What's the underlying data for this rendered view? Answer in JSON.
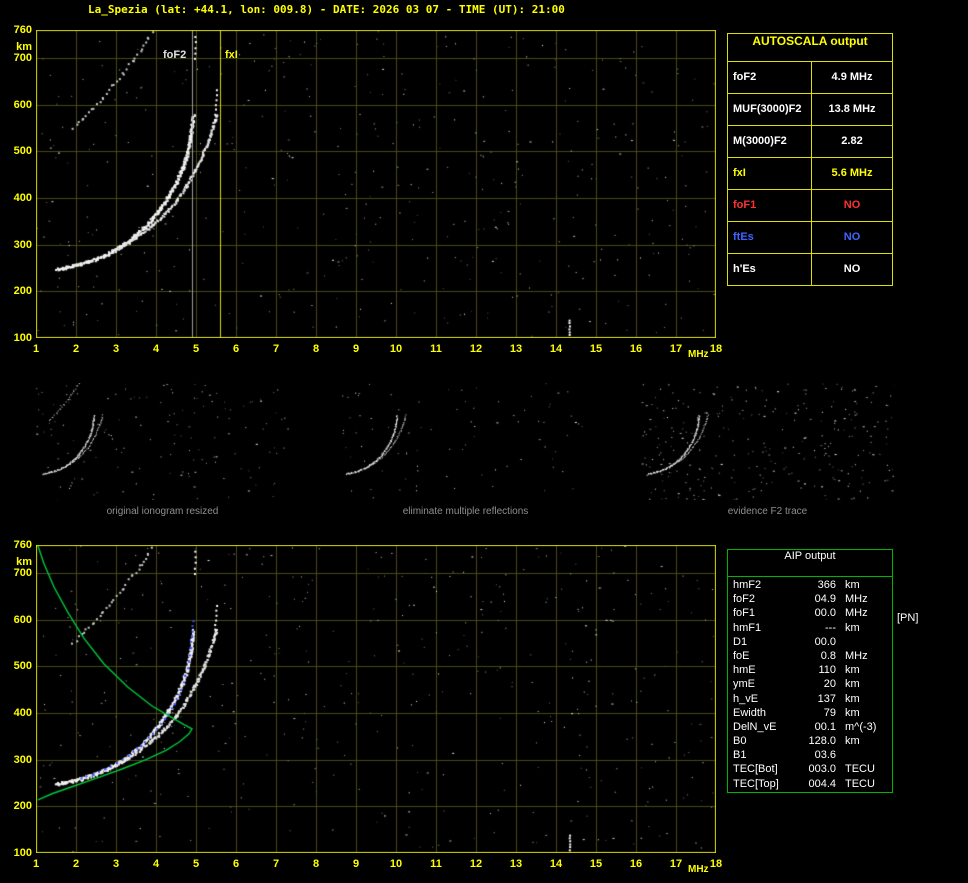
{
  "header": {
    "title": "La_Spezia (lat: +44.1, lon: 009.8) - DATE: 2026 03 07 - TIME (UT): 21:00"
  },
  "markers": {
    "fof2_label": "foF2",
    "fxi_label": "fxI"
  },
  "autoscala_table": {
    "title": "AUTOSCALA output",
    "rows": [
      {
        "label": "foF2",
        "value": "4.9 MHz",
        "color": "#ffffff"
      },
      {
        "label": "MUF(3000)F2",
        "value": "13.8 MHz",
        "color": "#ffffff"
      },
      {
        "label": "M(3000)F2",
        "value": "2.82",
        "color": "#ffffff"
      },
      {
        "label": "fxI",
        "value": "5.6 MHz",
        "color": "#ffff00"
      },
      {
        "label": "foF1",
        "value": "NO",
        "color": "#ff3232"
      },
      {
        "label": "ftEs",
        "value": "NO",
        "color": "#4064ff"
      },
      {
        "label": "h'Es",
        "value": "NO",
        "color": "#ffffff"
      }
    ]
  },
  "aip_table": {
    "title": "AIP output",
    "pn_note": "[PN]",
    "rows": [
      {
        "label": "hmF2",
        "value": "366",
        "unit": "km"
      },
      {
        "label": "foF2",
        "value": "04.9",
        "unit": "MHz"
      },
      {
        "label": "foF1",
        "value": "00.0",
        "unit": "MHz"
      },
      {
        "label": "hmF1",
        "value": "---",
        "unit": "km"
      },
      {
        "label": "D1",
        "value": "00.0",
        "unit": ""
      },
      {
        "label": "foE",
        "value": "0.8",
        "unit": "MHz"
      },
      {
        "label": "hmE",
        "value": "110",
        "unit": "km"
      },
      {
        "label": "ymE",
        "value": "20",
        "unit": "km"
      },
      {
        "label": "h_vE",
        "value": "137",
        "unit": "km"
      },
      {
        "label": "Ewidth",
        "value": "79",
        "unit": "km"
      },
      {
        "label": "DelN_vE",
        "value": "00.1",
        "unit": "m^(-3)"
      },
      {
        "label": "B0",
        "value": "128.0",
        "unit": "km"
      },
      {
        "label": "B1",
        "value": "03.6",
        "unit": ""
      },
      {
        "label": "TEC[Bot]",
        "value": "003.0",
        "unit": "TECU"
      },
      {
        "label": "TEC[Top]",
        "value": "004.4",
        "unit": "TECU"
      }
    ]
  },
  "thumbnails": [
    {
      "caption": "original ionogram resized"
    },
    {
      "caption": "eliminate multiple reflections"
    },
    {
      "caption": "evidence F2 trace"
    }
  ],
  "colors": {
    "background": "#000000",
    "axis_yellow": "#ffff00",
    "grid": "#4a4a14",
    "plot_border": "#d8d800",
    "trace_white": "#f2f2f2",
    "profile_green": "#00c83c",
    "restored_blue": "#4054ff",
    "autoscala_border": "#dede00",
    "aip_border": "#00b400",
    "no_red": "#ff3232",
    "es_blue": "#4064ff",
    "caption_gray": "#8f8f8f"
  },
  "chart_data": {
    "type": "scatter",
    "xlabel": "MHz",
    "ylabel": "km",
    "xlim": [
      1,
      18
    ],
    "ylim": [
      100,
      760
    ],
    "x_ticks": [
      1,
      2,
      3,
      4,
      5,
      6,
      7,
      8,
      9,
      10,
      11,
      12,
      13,
      14,
      15,
      16,
      17,
      18
    ],
    "y_ticks": [
      760,
      700,
      600,
      500,
      400,
      300,
      200,
      100
    ],
    "grid": true,
    "markers": {
      "foF2_MHz": 4.9,
      "fxI_MHz": 5.6
    },
    "traces": {
      "f2_o_mode": [
        [
          1.5,
          249
        ],
        [
          1.7,
          252
        ],
        [
          1.9,
          256
        ],
        [
          2.1,
          260
        ],
        [
          2.3,
          265
        ],
        [
          2.5,
          271
        ],
        [
          2.7,
          278
        ],
        [
          2.9,
          287
        ],
        [
          3.1,
          297
        ],
        [
          3.3,
          309
        ],
        [
          3.5,
          323
        ],
        [
          3.7,
          339
        ],
        [
          3.9,
          358
        ],
        [
          4.1,
          380
        ],
        [
          4.3,
          406
        ],
        [
          4.5,
          436
        ],
        [
          4.65,
          466
        ],
        [
          4.77,
          498
        ],
        [
          4.84,
          528
        ],
        [
          4.89,
          556
        ],
        [
          4.92,
          578
        ]
      ],
      "f2_x_mode": [
        [
          3.0,
          291
        ],
        [
          3.3,
          306
        ],
        [
          3.6,
          323
        ],
        [
          3.9,
          343
        ],
        [
          4.2,
          367
        ],
        [
          4.5,
          396
        ],
        [
          4.75,
          428
        ],
        [
          4.95,
          459
        ],
        [
          5.15,
          494
        ],
        [
          5.3,
          527
        ],
        [
          5.42,
          557
        ],
        [
          5.5,
          580
        ]
      ],
      "multiple_reflection": [
        [
          1.9,
          550
        ],
        [
          2.15,
          572
        ],
        [
          2.4,
          593
        ],
        [
          2.65,
          617
        ],
        [
          2.9,
          642
        ],
        [
          3.15,
          668
        ],
        [
          3.4,
          696
        ],
        [
          3.6,
          718
        ],
        [
          3.8,
          743
        ],
        [
          3.9,
          756
        ]
      ],
      "asymptote_dash_1": [
        [
          4.95,
          700
        ],
        [
          4.97,
          748
        ]
      ],
      "asymptote_dash_2": [
        [
          5.45,
          570
        ],
        [
          5.5,
          632
        ]
      ],
      "interference_dash": [
        [
          14.32,
          108
        ],
        [
          14.32,
          140
        ]
      ],
      "restored_trace": [
        [
          2.1,
          262
        ],
        [
          2.4,
          270
        ],
        [
          2.7,
          281
        ],
        [
          3.0,
          294
        ],
        [
          3.3,
          311
        ],
        [
          3.6,
          332
        ],
        [
          3.9,
          357
        ],
        [
          4.2,
          389
        ],
        [
          4.45,
          422
        ],
        [
          4.6,
          452
        ],
        [
          4.72,
          482
        ],
        [
          4.8,
          512
        ],
        [
          4.85,
          541
        ],
        [
          4.88,
          566
        ],
        [
          4.9,
          600
        ]
      ],
      "profile": [
        [
          1.05,
          758
        ],
        [
          1.2,
          720
        ],
        [
          1.45,
          670
        ],
        [
          1.8,
          615
        ],
        [
          2.2,
          560
        ],
        [
          2.7,
          505
        ],
        [
          3.3,
          455
        ],
        [
          3.9,
          415
        ],
        [
          4.4,
          390
        ],
        [
          4.7,
          375
        ],
        [
          4.9,
          366
        ],
        [
          4.83,
          356
        ],
        [
          4.6,
          339
        ],
        [
          4.25,
          320
        ],
        [
          3.75,
          300
        ],
        [
          3.15,
          280
        ],
        [
          2.5,
          260
        ],
        [
          1.9,
          242
        ],
        [
          1.4,
          227
        ],
        [
          1.05,
          214
        ]
      ]
    }
  }
}
